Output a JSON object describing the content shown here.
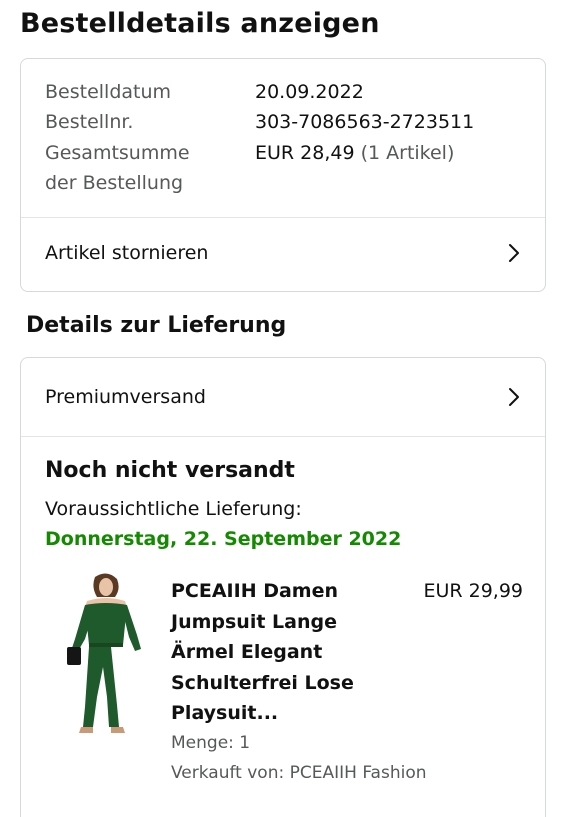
{
  "page": {
    "title": "Bestelldetails anzeigen"
  },
  "summary": {
    "order_date_label": "Bestelldatum",
    "order_date": "20.09.2022",
    "order_number_label": "Bestellnr.",
    "order_number": "303-7086563-2723511",
    "total_label_line1": "Gesamtsumme",
    "total_label_line2": "der Bestellung",
    "total_value": "EUR 28,49",
    "item_count": "(1 Artikel)",
    "cancel_label": "Artikel stornieren"
  },
  "delivery": {
    "section_title": "Details zur Lieferung",
    "shipping_method": "Premiumversand",
    "status": "Noch nicht versandt",
    "eta_label": "Voraussichtliche Lieferung:",
    "eta_date": "Donnerstag, 22. September 2022",
    "accent_color": "#138a00"
  },
  "product": {
    "title_lines": [
      "PCEAIIH Damen",
      "Jumpsuit Lange",
      "Ärmel Elegant",
      "Schulterfrei Lose",
      "Playsuit..."
    ],
    "price": "EUR 29,99",
    "quantity": "Menge: 1",
    "seller": "Verkauft von: PCEAIIH Fashion",
    "image_icon": "green-jumpsuit-photo"
  },
  "icons": {
    "chevron": "chevron-right-icon"
  }
}
